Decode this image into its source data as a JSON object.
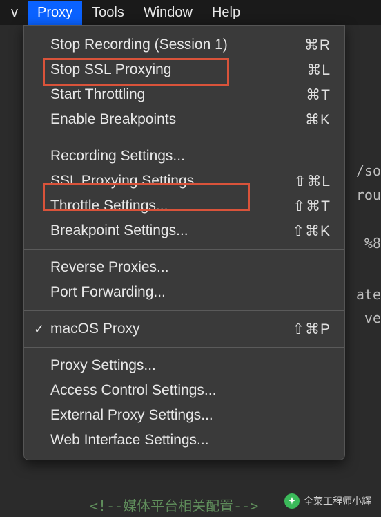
{
  "menubar": {
    "items": [
      {
        "label": "v",
        "active": false
      },
      {
        "label": "Proxy",
        "active": true
      },
      {
        "label": "Tools",
        "active": false
      },
      {
        "label": "Window",
        "active": false
      },
      {
        "label": "Help",
        "active": false
      }
    ]
  },
  "menu": {
    "groups": [
      [
        {
          "label": "Stop Recording (Session 1)",
          "shortcut": "⌘R",
          "checked": false
        },
        {
          "label": "Stop SSL Proxying",
          "shortcut": "⌘L",
          "checked": false,
          "highlighted": true
        },
        {
          "label": "Start Throttling",
          "shortcut": "⌘T",
          "checked": false
        },
        {
          "label": "Enable Breakpoints",
          "shortcut": "⌘K",
          "checked": false
        }
      ],
      [
        {
          "label": "Recording Settings...",
          "shortcut": "",
          "checked": false
        },
        {
          "label": "SSL Proxying Settings...",
          "shortcut": "⇧⌘L",
          "checked": false,
          "highlighted": true
        },
        {
          "label": "Throttle Settings...",
          "shortcut": "⇧⌘T",
          "checked": false
        },
        {
          "label": "Breakpoint Settings...",
          "shortcut": "⇧⌘K",
          "checked": false
        }
      ],
      [
        {
          "label": "Reverse Proxies...",
          "shortcut": "",
          "checked": false
        },
        {
          "label": "Port Forwarding...",
          "shortcut": "",
          "checked": false
        }
      ],
      [
        {
          "label": "macOS Proxy",
          "shortcut": "⇧⌘P",
          "checked": true
        }
      ],
      [
        {
          "label": "Proxy Settings...",
          "shortcut": "",
          "checked": false
        },
        {
          "label": "Access Control Settings...",
          "shortcut": "",
          "checked": false
        },
        {
          "label": "External Proxy Settings...",
          "shortcut": "",
          "checked": false
        },
        {
          "label": "Web Interface Settings...",
          "shortcut": "",
          "checked": false
        }
      ]
    ]
  },
  "background": {
    "frag1": "/so",
    "frag2": "rou",
    "frag3": "%8",
    "frag4": "ate",
    "frag5": "ve"
  },
  "footer_code": "<!--媒体平台相关配置-->",
  "watermark": "全菜工程师小辉"
}
